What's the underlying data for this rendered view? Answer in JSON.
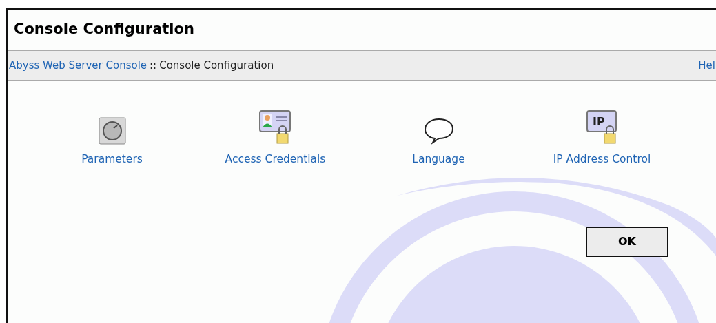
{
  "page": {
    "title": "Console Configuration"
  },
  "breadcrumb": {
    "link": "Abyss Web Server Console",
    "separator": "::",
    "current": "Console Configuration",
    "help": "Hel"
  },
  "options": [
    {
      "kind": "knob",
      "label": "Parameters"
    },
    {
      "kind": "card-lock",
      "label": "Access Credentials"
    },
    {
      "kind": "speech",
      "label": "Language"
    },
    {
      "kind": "ip-lock",
      "label": "IP Address Control",
      "icon_text": "IP"
    }
  ],
  "buttons": [
    {
      "label": "OK"
    }
  ]
}
